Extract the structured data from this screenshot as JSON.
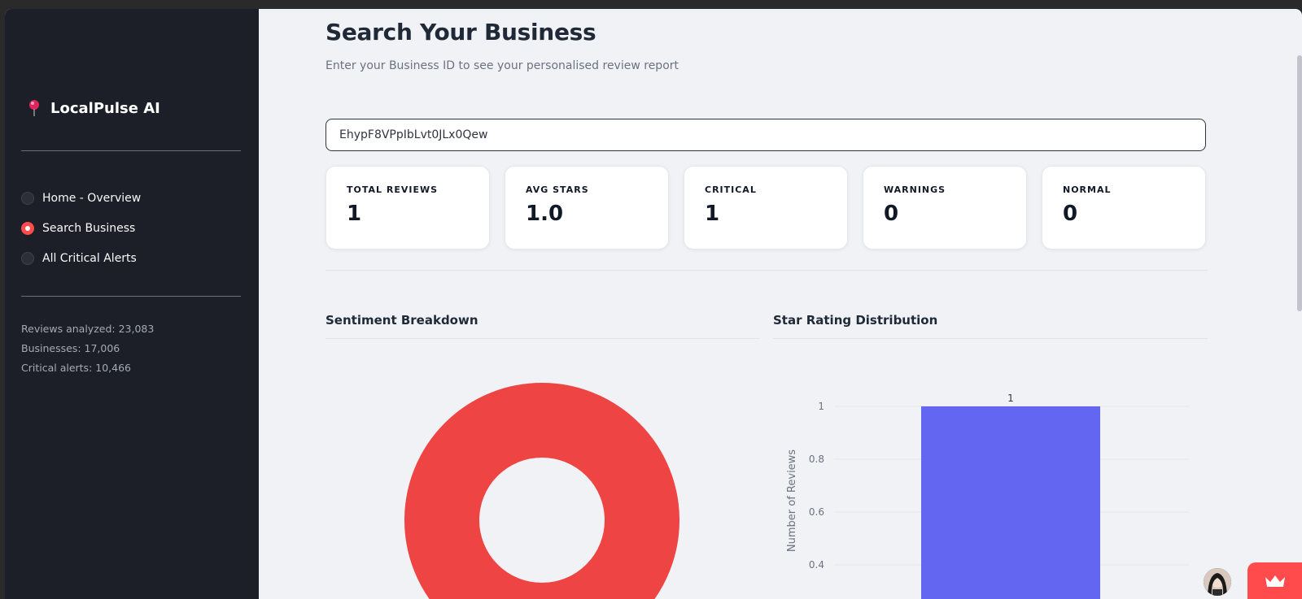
{
  "sidebar": {
    "brand": "LocalPulse AI",
    "nav": [
      {
        "label": "Home - Overview",
        "selected": false
      },
      {
        "label": "Search Business",
        "selected": true
      },
      {
        "label": "All Critical Alerts",
        "selected": false
      }
    ],
    "stats": {
      "reviews": "Reviews analyzed: 23,083",
      "businesses": "Businesses: 17,006",
      "alerts": "Critical alerts: 10,466"
    }
  },
  "main": {
    "title": "Search Your Business",
    "subtitle": "Enter your Business ID to see your personalised review report",
    "search_value": "EhypF8VPpIbLvt0JLx0Qew",
    "metrics": [
      {
        "label": "TOTAL REVIEWS",
        "value": "1"
      },
      {
        "label": "AVG STARS",
        "value": "1.0"
      },
      {
        "label": "CRITICAL",
        "value": "1"
      },
      {
        "label": "WARNINGS",
        "value": "0"
      },
      {
        "label": "NORMAL",
        "value": "0"
      }
    ],
    "sentiment_title": "Sentiment Breakdown",
    "star_title": "Star Rating Distribution"
  },
  "colors": {
    "sidebar_bg": "#1c1f28",
    "accent": "#ff4b4b",
    "donut": "#ef4444",
    "bar": "#6366f1"
  },
  "chart_data": [
    {
      "type": "pie",
      "title": "Sentiment Breakdown",
      "hole": true,
      "slices": [
        {
          "value": 1,
          "color": "#ef4444"
        }
      ]
    },
    {
      "type": "bar",
      "title": "Star Rating Distribution",
      "ylabel": "Number of Reviews",
      "yticks": [
        "1",
        "0.8",
        "0.6",
        "0.4"
      ],
      "ylim": [
        0,
        1
      ],
      "bars": [
        {
          "value": 1,
          "label": "1",
          "color": "#6366f1"
        }
      ],
      "visible_ylim": [
        0.37,
        1.0
      ]
    }
  ]
}
